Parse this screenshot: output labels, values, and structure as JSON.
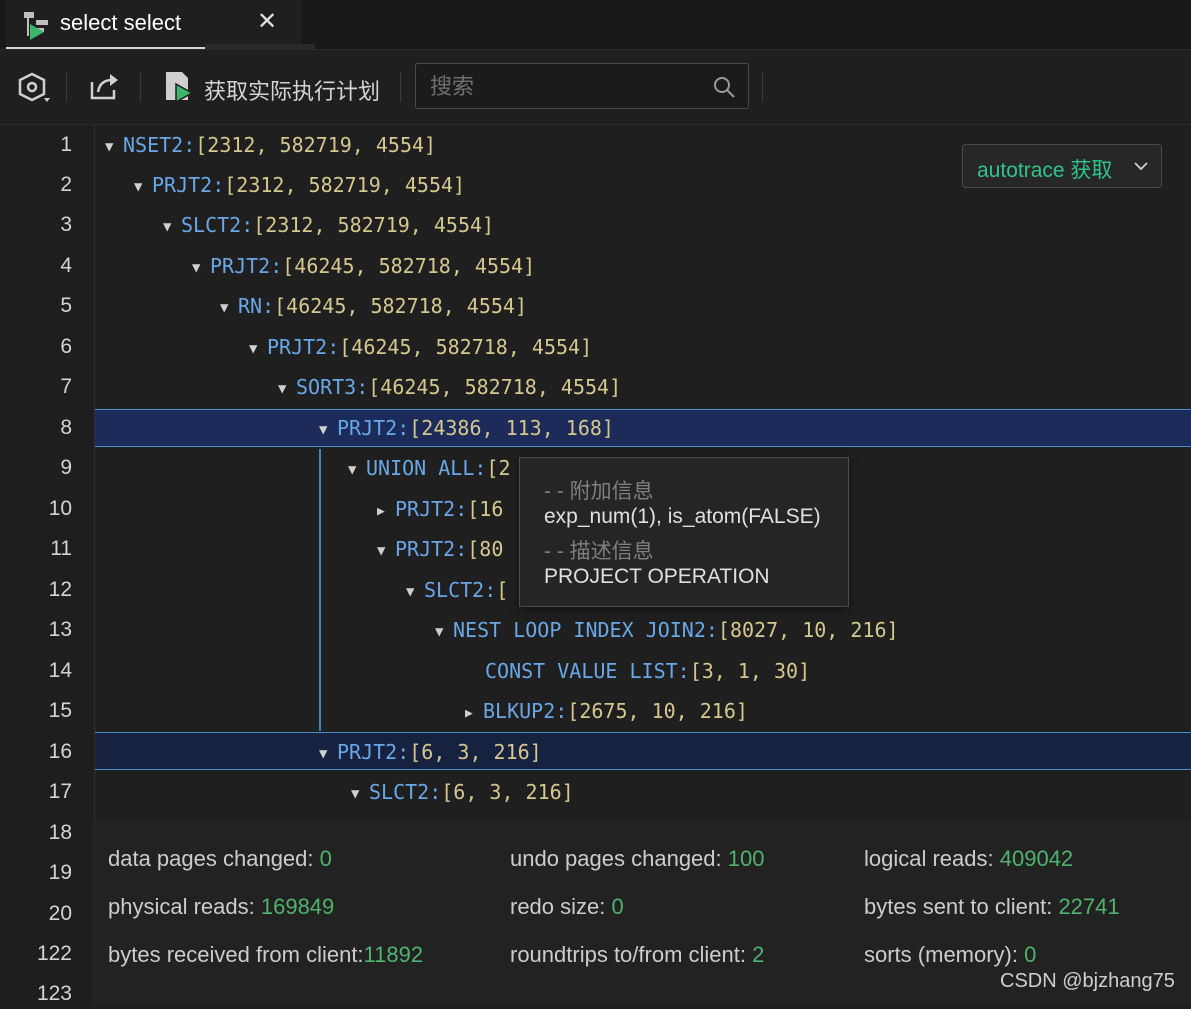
{
  "tab": {
    "title": "select select",
    "close_glyph": "✕",
    "icon": "query-plan-icon"
  },
  "toolbar": {
    "settings_icon": "settings-icon",
    "export_icon": "export-icon",
    "exec_plan_icon": "execution-plan-icon",
    "exec_plan_label": "获取实际执行计划",
    "search_placeholder": "搜索",
    "search_icon": "search-icon"
  },
  "line_numbers": [
    "1",
    "2",
    "3",
    "4",
    "5",
    "6",
    "7",
    "8",
    "9",
    "10",
    "11",
    "12",
    "13",
    "14",
    "15",
    "16",
    "17",
    "18",
    "19",
    "20",
    "122",
    "123"
  ],
  "tree": [
    {
      "name": "NSET2:",
      "value": "[2312, 582719, 4554]",
      "caret": "down"
    },
    {
      "name": "PRJT2:",
      "value": "[2312, 582719, 4554]",
      "caret": "down"
    },
    {
      "name": "SLCT2:",
      "value": "[2312, 582719, 4554]",
      "caret": "down"
    },
    {
      "name": "PRJT2:",
      "value": "[46245, 582718, 4554]",
      "caret": "down"
    },
    {
      "name": "RN:",
      "value": "[46245, 582718, 4554]",
      "caret": "down"
    },
    {
      "name": "PRJT2:",
      "value": "[46245, 582718, 4554]",
      "caret": "down"
    },
    {
      "name": "SORT3:",
      "value": "[46245, 582718, 4554]",
      "caret": "down"
    },
    {
      "name": "PRJT2:",
      "value": "[24386, 113, 168]",
      "caret": "down"
    },
    {
      "name": "UNION ALL:",
      "value": "[2",
      "caret": "down"
    },
    {
      "name": "PRJT2:",
      "value": "[16",
      "caret": "right"
    },
    {
      "name": "PRJT2:",
      "value": "[80",
      "caret": "down"
    },
    {
      "name": "SLCT2:",
      "value": "[",
      "caret": "down"
    },
    {
      "name": "NEST LOOP INDEX JOIN2:",
      "value": "[8027, 10, 216]",
      "caret": "down"
    },
    {
      "name": "CONST VALUE LIST:",
      "value": "[3, 1, 30]",
      "caret": "none"
    },
    {
      "name": "BLKUP2:",
      "value": "[2675, 10, 216]",
      "caret": "right"
    },
    {
      "name": "PRJT2:",
      "value": "[6, 3, 216]",
      "caret": "down"
    },
    {
      "name": "SLCT2:",
      "value": "[6, 3, 216]",
      "caret": "down"
    }
  ],
  "autotrace": {
    "label": "autotrace 获取",
    "icon": "chevron-down-icon"
  },
  "tooltip": {
    "header1": "- - 附加信息",
    "line1": "exp_num(1), is_atom(FALSE)",
    "header2": "- - 描述信息",
    "line2": "PROJECT OPERATION"
  },
  "stats": [
    {
      "label": "data pages changed: ",
      "value": "0"
    },
    {
      "label": "undo pages changed: ",
      "value": "100"
    },
    {
      "label": "logical reads: ",
      "value": "409042"
    },
    {
      "label": "physical reads: ",
      "value": "169849"
    },
    {
      "label": "redo size: ",
      "value": "0"
    },
    {
      "label": "bytes sent to client: ",
      "value": "22741"
    },
    {
      "label": "bytes received from client:",
      "value": "11892"
    },
    {
      "label": "roundtrips to/from client: ",
      "value": "2"
    },
    {
      "label": "sorts (memory): ",
      "value": "0"
    }
  ],
  "watermark": "CSDN @bjzhang75",
  "colors": {
    "node_name": "#69a7e7",
    "node_value": "#d5c88e",
    "stat_value": "#4fb36e",
    "autotrace": "#2fc58c",
    "selection": "#1c2b59"
  }
}
